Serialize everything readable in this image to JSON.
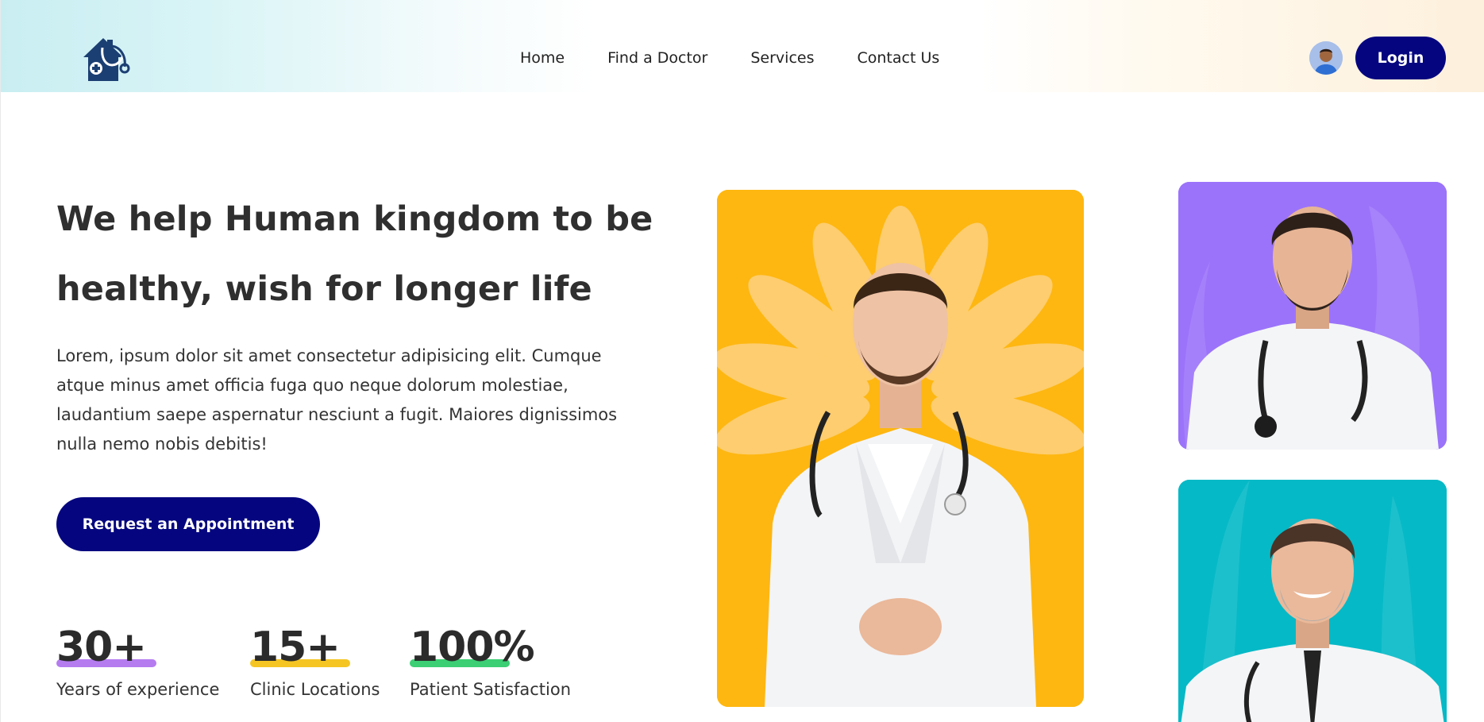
{
  "brand": {
    "logo_icon": "house-stethoscope-icon"
  },
  "nav": {
    "items": [
      "Home",
      "Find a Doctor",
      "Services",
      "Contact Us"
    ]
  },
  "header": {
    "avatar_icon": "user-avatar",
    "login_label": "Login"
  },
  "hero": {
    "title_line1": "We help Human kingdom to be",
    "title_line2": "healthy, wish for longer life",
    "description": "Lorem, ipsum dolor sit amet consectetur adipisicing elit. Cumque atque minus amet officia fuga quo neque dolorum molestiae, laudantium saepe aspernatur nesciunt a fugit. Maiores dignissimos nulla nemo nobis debitis!",
    "cta_label": "Request an Appointment"
  },
  "stats": [
    {
      "value": "30+",
      "label": "Years of experience",
      "accent": "#b57cf0"
    },
    {
      "value": "15+",
      "label": "Clinic Locations",
      "accent": "#f5c524"
    },
    {
      "value": "100%",
      "label": "Patient Satisfaction",
      "accent": "#3ccf74"
    }
  ],
  "images": {
    "main": {
      "subject": "doctor-portrait",
      "background": "#feb711"
    },
    "top": {
      "subject": "doctor-portrait",
      "background": "#9b73fa"
    },
    "bottom": {
      "subject": "doctor-portrait",
      "background": "#06b9c6"
    }
  },
  "colors": {
    "primary": "#05067f",
    "text": "#2f2f2f"
  }
}
